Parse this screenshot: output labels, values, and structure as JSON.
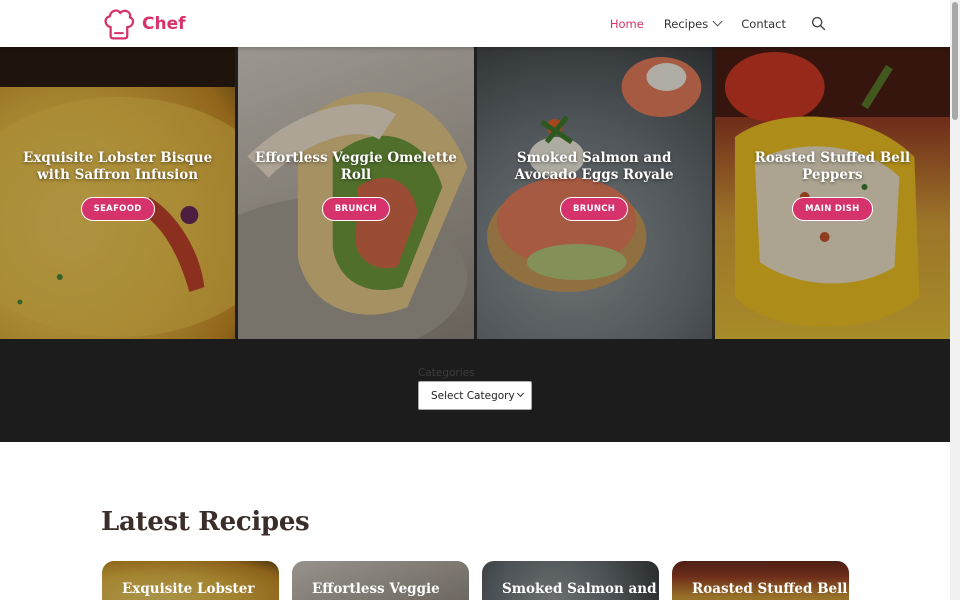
{
  "header": {
    "brand": "Chef",
    "nav": [
      {
        "label": "Home",
        "active": true
      },
      {
        "label": "Recipes",
        "active": false
      },
      {
        "label": "Contact",
        "active": false
      }
    ],
    "accent_color": "#d6336c"
  },
  "hero": {
    "cards": [
      {
        "title": "Exquisite Lobster Bisque with Saffron Infusion",
        "category": "SEAFOOD"
      },
      {
        "title": "Effortless Veggie Omelette Roll",
        "category": "BRUNCH"
      },
      {
        "title": "Smoked Salmon and Avocado Eggs Royale",
        "category": "BRUNCH"
      },
      {
        "title": "Roasted Stuffed Bell Peppers",
        "category": "MAIN DISH"
      }
    ]
  },
  "categories": {
    "label": "Categories",
    "select_value": "Select Category"
  },
  "latest": {
    "heading": "Latest Recipes",
    "cards": [
      {
        "title": "Exquisite Lobster"
      },
      {
        "title": "Effortless Veggie"
      },
      {
        "title": "Smoked Salmon and"
      },
      {
        "title": "Roasted Stuffed Bell"
      }
    ]
  }
}
